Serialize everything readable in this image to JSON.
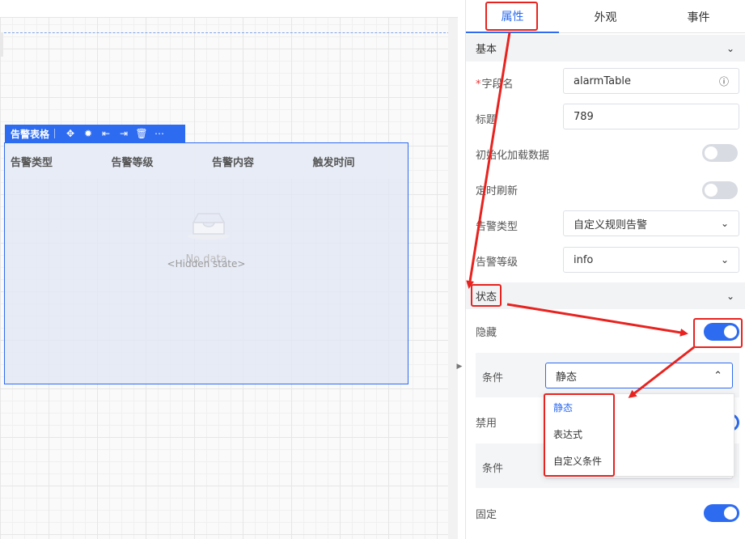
{
  "canvas": {
    "toolbar": {
      "name": "告警表格",
      "icons": [
        "move-icon",
        "bug-icon",
        "align-left-icon",
        "align-right-icon",
        "trash-icon",
        "more-icon"
      ],
      "glyphs": [
        "✥",
        "✹",
        "⇤",
        "⇥",
        "🗑",
        "⋯"
      ]
    },
    "table": {
      "columns": [
        "告警类型",
        "告警等级",
        "告警内容",
        "触发时间"
      ],
      "empty_text": "No data",
      "overlay_text": "<Hidden state>"
    }
  },
  "panel": {
    "tabs": [
      "属性",
      "外观",
      "事件"
    ],
    "active_tab": "属性",
    "basic": {
      "title": "基本",
      "fields": {
        "field_name": {
          "label": "字段名",
          "value": "alarmTable"
        },
        "title": {
          "label": "标题",
          "value": "789"
        },
        "init_load": {
          "label": "初始化加载数据"
        },
        "timed_refresh": {
          "label": "定时刷新"
        },
        "alarm_type": {
          "label": "告警类型",
          "value": "自定义规则告警"
        },
        "alarm_level": {
          "label": "告警等级",
          "value": "info"
        }
      }
    },
    "state": {
      "title": "状态",
      "hidden": {
        "label": "隐藏",
        "on": true
      },
      "hidden_condition": {
        "label": "条件",
        "value": "静态"
      },
      "disabled": {
        "label": "禁用",
        "on": true
      },
      "disabled_condition": {
        "label": "条件"
      },
      "fixed": {
        "label": "固定",
        "on": true
      }
    },
    "dropdown": {
      "options": [
        "静态",
        "表达式",
        "自定义条件"
      ],
      "selected": "静态"
    }
  },
  "colors": {
    "accent": "#2d6bf0",
    "annotation": "#e8231f"
  }
}
